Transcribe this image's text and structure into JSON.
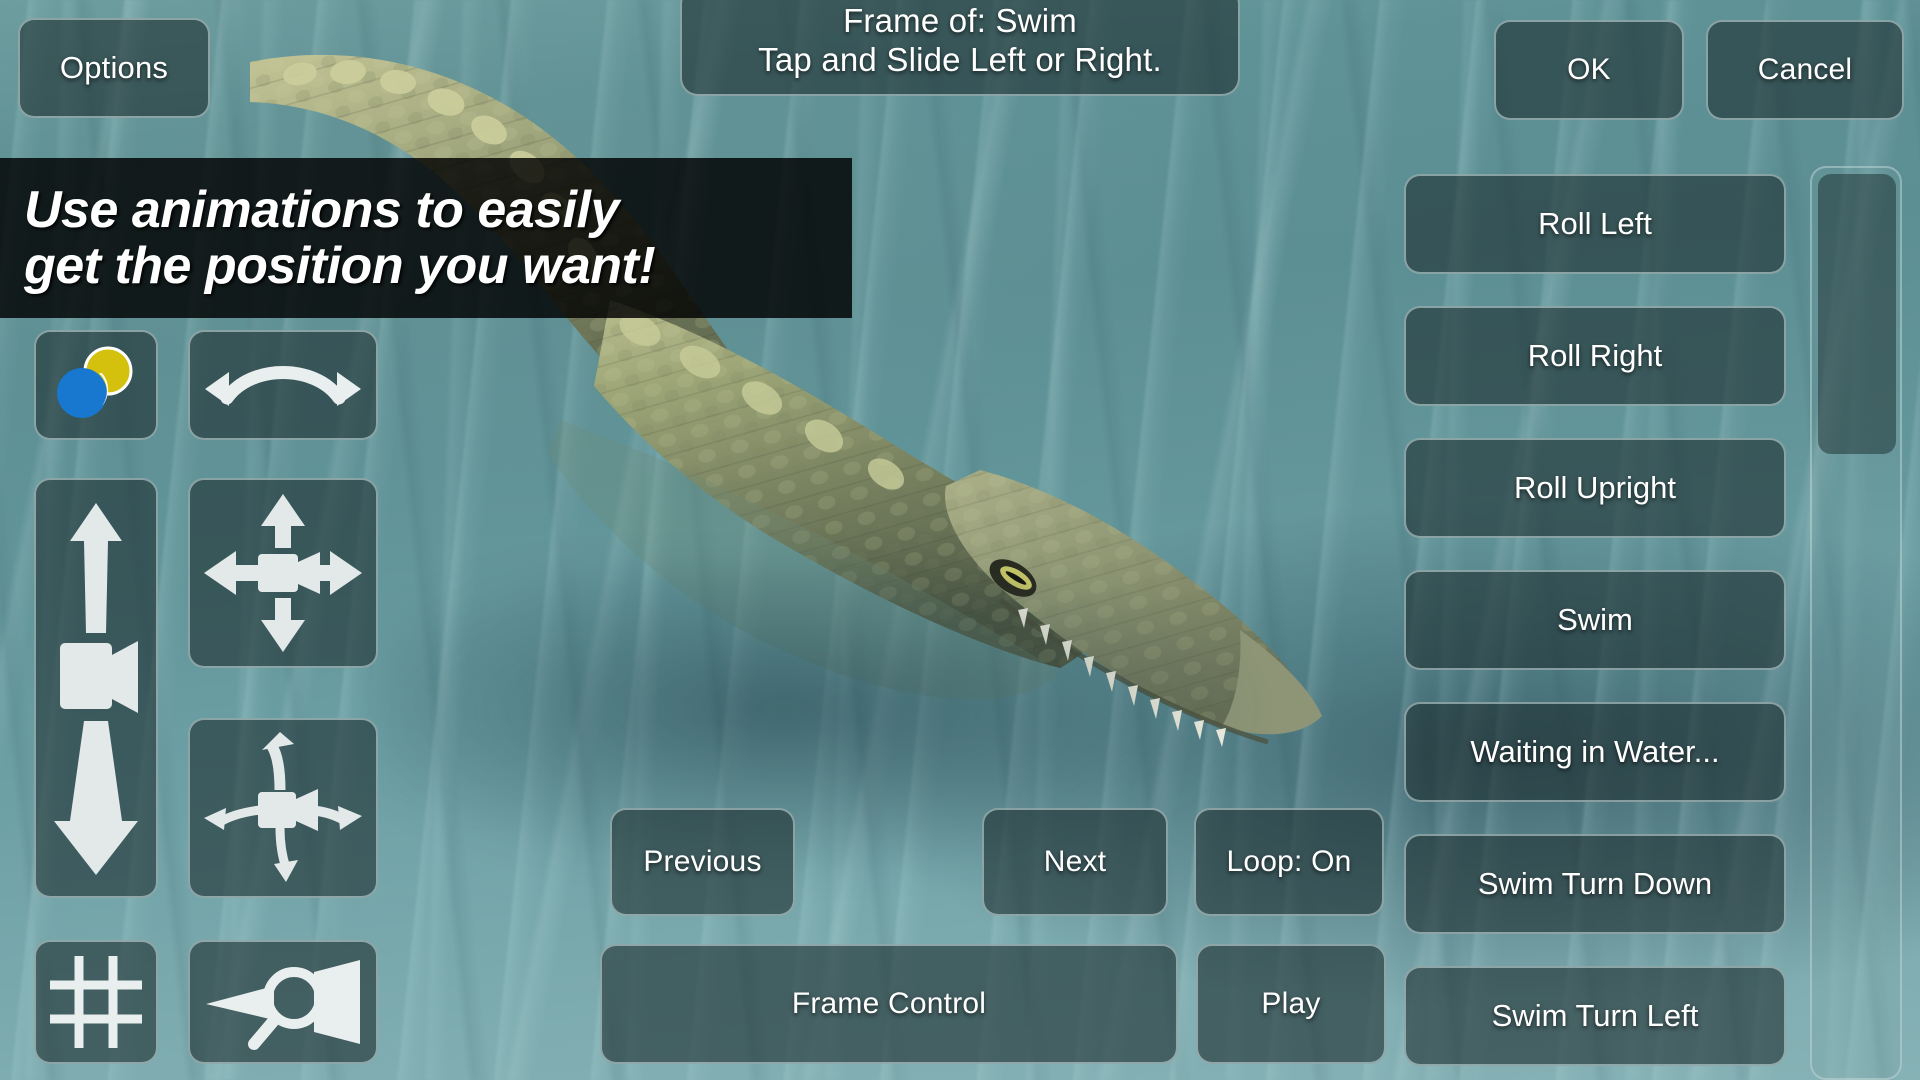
{
  "app": {
    "scene_description": "3D crocodile model floating in teal water"
  },
  "header": {
    "options_label": "Options",
    "title_line1": "Frame of: Swim",
    "title_line2": "Tap and Slide Left or Right.",
    "ok_label": "OK",
    "cancel_label": "Cancel"
  },
  "promo": {
    "line1": "Use animations to easily",
    "line2": "get the position you want!"
  },
  "left_tools": [
    {
      "name": "color-picker-icon",
      "label": "Colors"
    },
    {
      "name": "orbit-camera-icon",
      "label": "Orbit Camera"
    },
    {
      "name": "dolly-camera-icon",
      "label": "Dolly Camera"
    },
    {
      "name": "pan-camera-icon",
      "label": "Pan Camera"
    },
    {
      "name": "move-camera-3d-icon",
      "label": "Move Camera 3D"
    },
    {
      "name": "grid-icon",
      "label": "Grid"
    },
    {
      "name": "zoom-camera-icon",
      "label": "Zoom Camera"
    }
  ],
  "playback": {
    "previous_label": "Previous",
    "next_label": "Next",
    "loop_label": "Loop: On",
    "frame_control_label": "Frame Control",
    "play_label": "Play"
  },
  "animations": {
    "items": [
      {
        "label": "Roll Left"
      },
      {
        "label": "Roll Right"
      },
      {
        "label": "Roll Upright"
      },
      {
        "label": "Swim"
      },
      {
        "label": "Waiting in Water..."
      },
      {
        "label": "Swim Turn Down"
      },
      {
        "label": "Swim Turn Left"
      }
    ]
  },
  "colors": {
    "water": "#63969a",
    "panel": "rgba(30,48,50,0.62)",
    "panel_border": "rgba(205,225,225,0.55)",
    "text": "#ffffff",
    "banner_bg": "#000000",
    "icon_blue": "#1878d0",
    "icon_yellow": "#d4c10d"
  }
}
